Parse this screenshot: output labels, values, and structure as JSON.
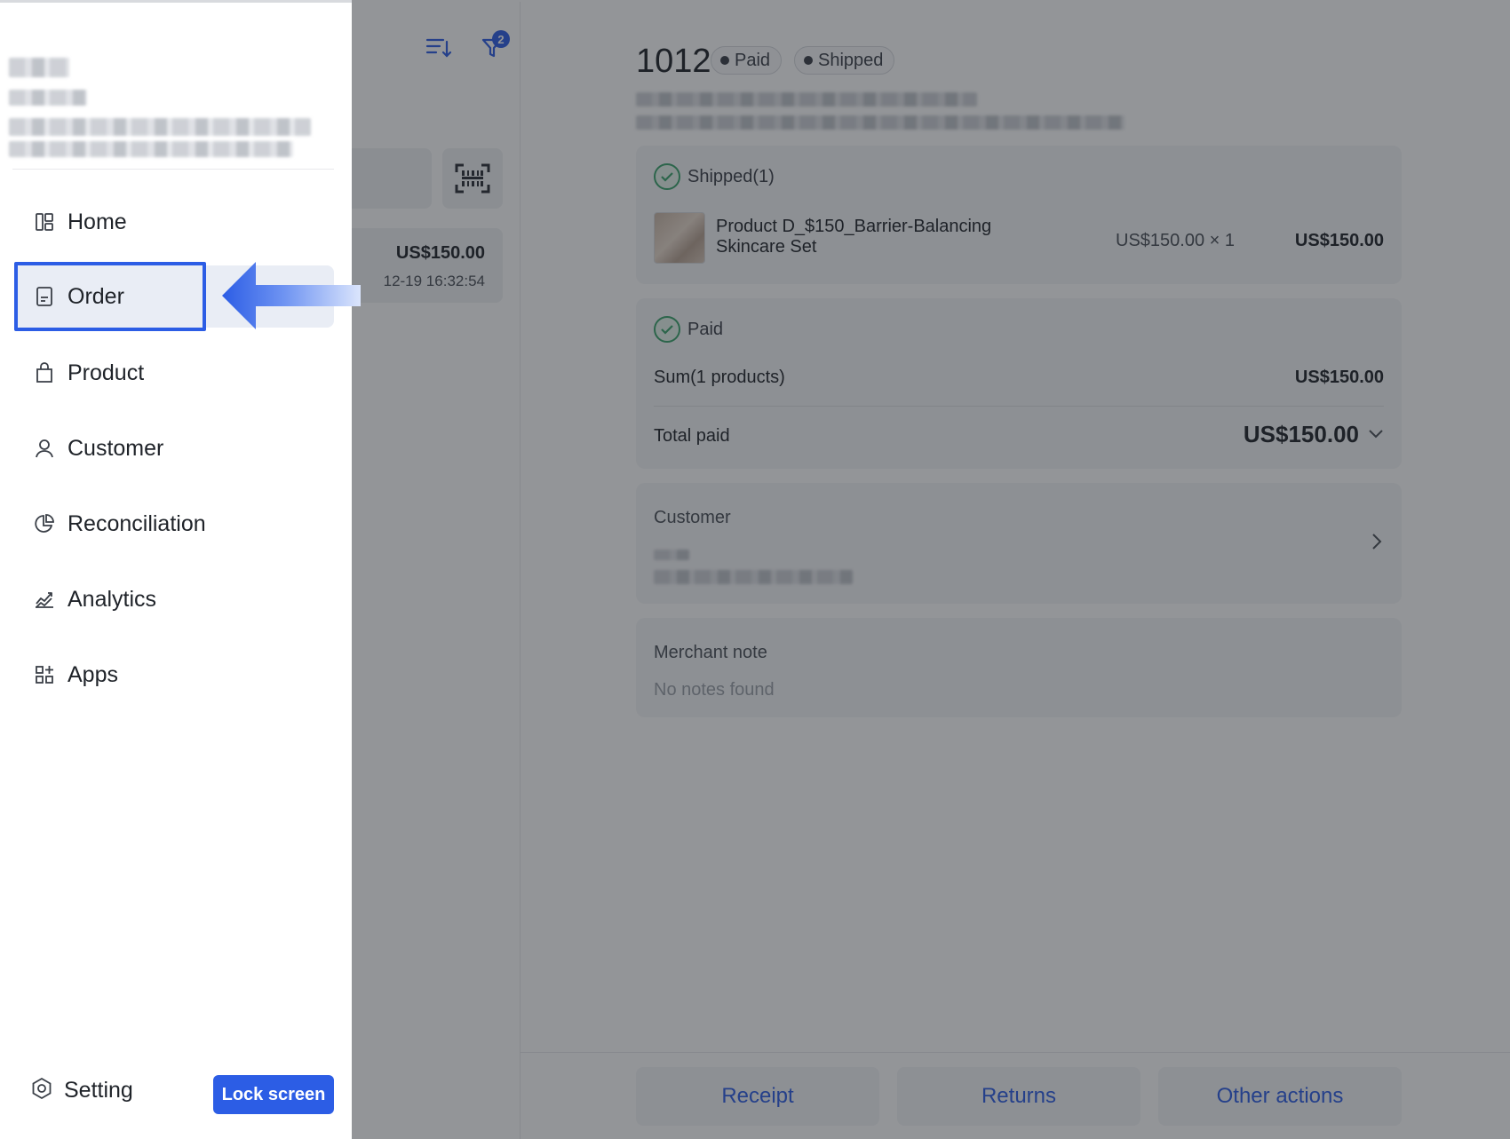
{
  "colors": {
    "accent": "#2c5de5",
    "paid_check": "#3aa36c",
    "overlay": "rgba(30,33,40,0.48)"
  },
  "drawer": {
    "nav": [
      {
        "label": "Home",
        "icon": "dashboard-icon"
      },
      {
        "label": "Order",
        "icon": "document-icon",
        "active": true
      },
      {
        "label": "Product",
        "icon": "shopping-bag-icon"
      },
      {
        "label": "Customer",
        "icon": "person-icon"
      },
      {
        "label": "Reconciliation",
        "icon": "pie-chart-icon"
      },
      {
        "label": "Analytics",
        "icon": "line-chart-icon"
      },
      {
        "label": "Apps",
        "icon": "apps-grid-icon"
      }
    ],
    "setting_label": "Setting",
    "lock_label": "Lock screen"
  },
  "list": {
    "filter_count": "2",
    "order_card": {
      "amount": "US$150.00",
      "time": "12-19 16:32:54"
    }
  },
  "order": {
    "number": "1012",
    "statuses": [
      "Paid",
      "Shipped"
    ],
    "shipment": {
      "title": "Shipped(1)",
      "item": {
        "name": "Product D_$150_Barrier-Balancing Skincare Set",
        "unit_qty": "US$150.00 × 1",
        "total": "US$150.00"
      }
    },
    "payment": {
      "title": "Paid",
      "sum_label": "Sum(1 products)",
      "sum_value": "US$150.00",
      "total_label": "Total paid",
      "total_value": "US$150.00"
    },
    "customer": {
      "title": "Customer"
    },
    "note": {
      "title": "Merchant note",
      "empty": "No notes found"
    },
    "actions": {
      "receipt": "Receipt",
      "returns": "Returns",
      "other": "Other actions"
    }
  }
}
